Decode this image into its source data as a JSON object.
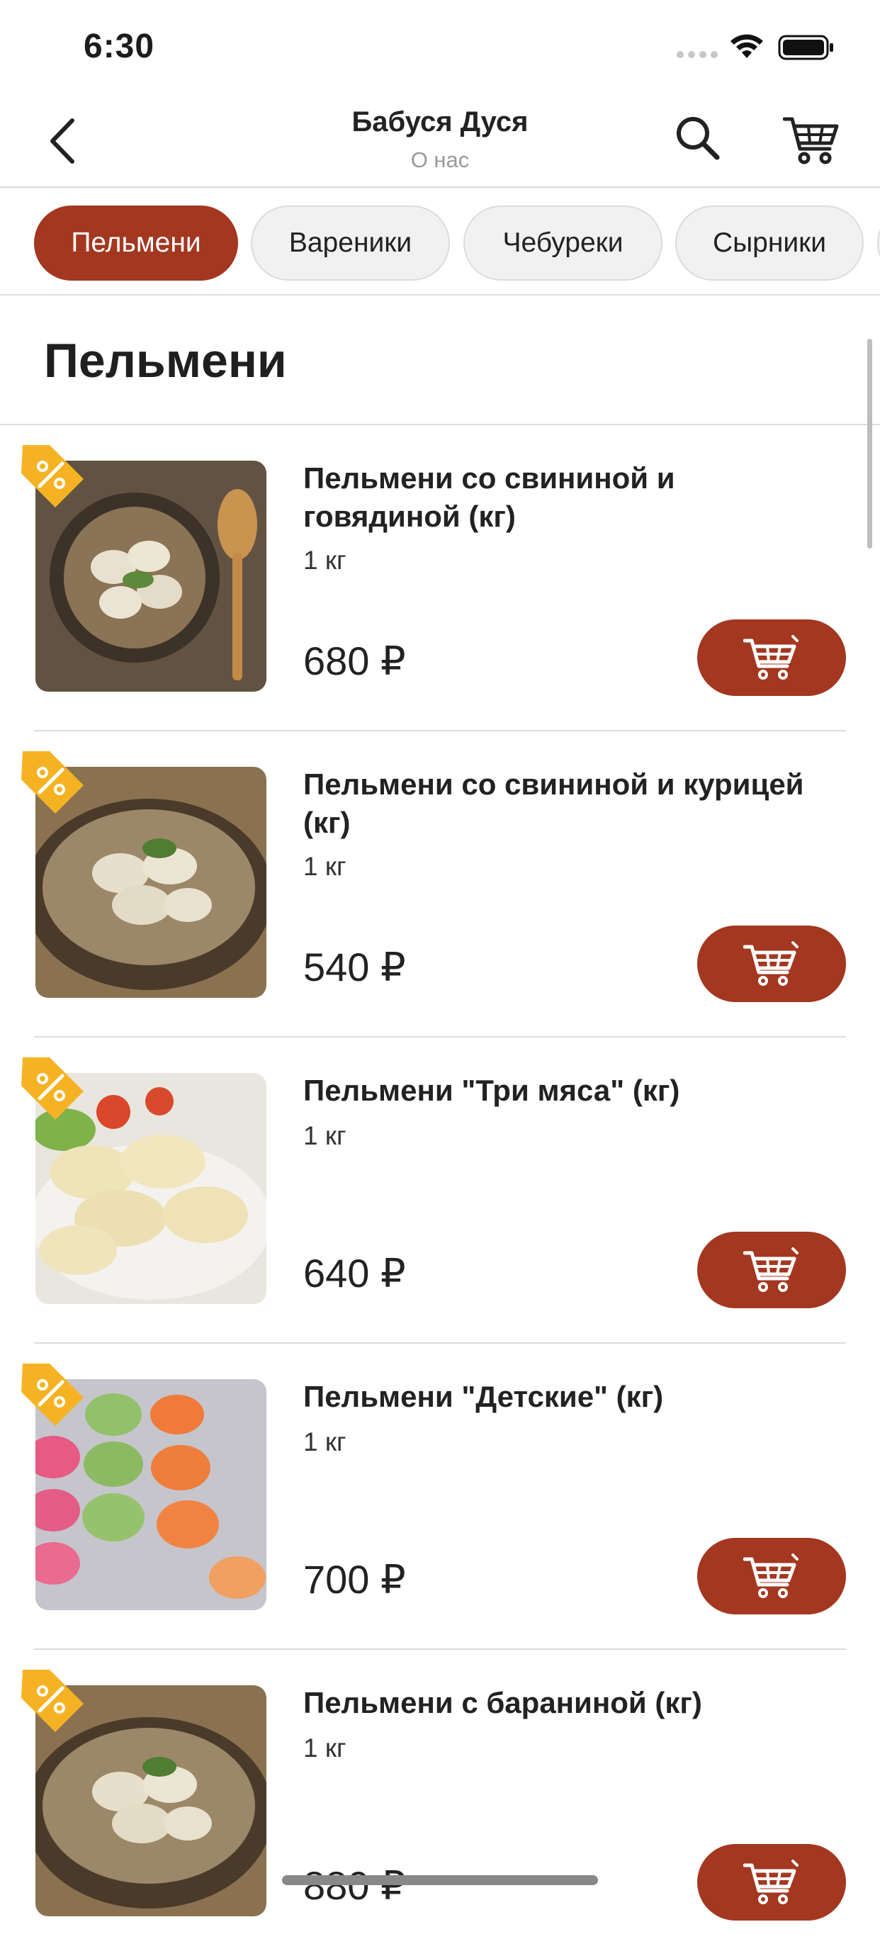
{
  "status_bar": {
    "time": "6:30"
  },
  "header": {
    "title": "Бабуся Дуся",
    "subtitle": "О нас"
  },
  "tabs": [
    {
      "label": "Пельмени",
      "active": true
    },
    {
      "label": "Вареники",
      "active": false
    },
    {
      "label": "Чебуреки",
      "active": false
    },
    {
      "label": "Сырники",
      "active": false
    }
  ],
  "section": {
    "title": "Пельмени"
  },
  "products": [
    {
      "title": "Пельмени со свининой и говядиной (кг)",
      "weight": "1 кг",
      "price": "680 ₽",
      "image": "dumplings-bowl-with-spoon"
    },
    {
      "title": "Пельмени со свининой и курицей (кг)",
      "weight": "1 кг",
      "price": "540 ₽",
      "image": "dumplings-bowl"
    },
    {
      "title": "Пельмени \"Три мяса\" (кг)",
      "weight": "1 кг",
      "price": "640 ₽",
      "image": "dumplings-plate-tomatoes"
    },
    {
      "title": "Пельмени \"Детские\" (кг)",
      "weight": "1 кг",
      "price": "700 ₽",
      "image": "colored-dumplings"
    },
    {
      "title": "Пельмени с бараниной (кг)",
      "weight": "1 кг",
      "price": "880 ₽",
      "image": "dumplings-bowl"
    }
  ],
  "colors": {
    "accent": "#a33720",
    "badge": "#f5b324",
    "tab_inactive_bg": "#f1f1f1"
  },
  "icons": [
    "back-chevron-icon",
    "search-icon",
    "cart-icon",
    "discount-tag-icon",
    "add-to-cart-icon"
  ]
}
